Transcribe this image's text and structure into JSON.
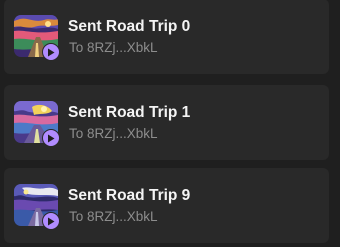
{
  "transactions": [
    {
      "title": "Sent Road Trip 0",
      "recipient": "To 8RZj...XbkL",
      "thumb_icon": "nft-painting-thumbnail",
      "badge_icon": "send-arrow-icon"
    },
    {
      "title": "Sent Road Trip 1",
      "recipient": "To 8RZj...XbkL",
      "thumb_icon": "nft-painting-thumbnail",
      "badge_icon": "send-arrow-icon"
    },
    {
      "title": "Sent Road Trip 9",
      "recipient": "To 8RZj...XbkL",
      "thumb_icon": "nft-painting-thumbnail",
      "badge_icon": "send-arrow-icon"
    }
  ],
  "colors": {
    "background": "#1f1f1f",
    "card": "#292929",
    "badge": "#b18cff",
    "title": "#f4f4f4",
    "subtitle": "#8d8d8d"
  }
}
